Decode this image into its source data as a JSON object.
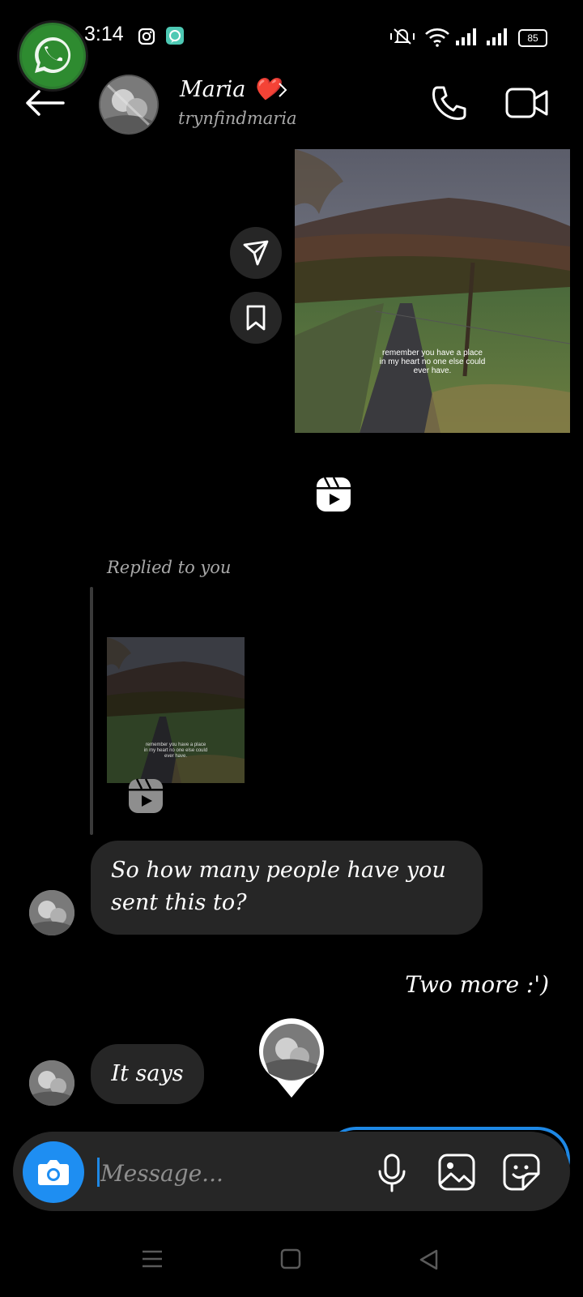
{
  "status_bar": {
    "time": "3:14",
    "battery": "85",
    "icons": [
      "whatsapp-bubble-icon",
      "instagram-icon",
      "chat-app-icon",
      "mute-vibrate-icon",
      "wifi-icon",
      "signal-icon",
      "signal-icon",
      "battery-icon"
    ]
  },
  "header": {
    "name": "Maria ❤️",
    "username": "trynfindmaria",
    "icons": [
      "back-arrow-icon",
      "chevron-right-icon",
      "phone-icon",
      "video-call-icon"
    ]
  },
  "shared_post": {
    "caption_lines": [
      "remember you have a place",
      "in my heart no one else could",
      "ever have."
    ],
    "icons": [
      "send-icon",
      "bookmark-icon",
      "reels-icon"
    ]
  },
  "reply": {
    "label": "Replied to you",
    "caption_lines": [
      "remember you have a place",
      "in my heart no one else could",
      "ever have."
    ]
  },
  "messages": [
    {
      "from": "them",
      "text": "So how many people have you sent this to?"
    },
    {
      "from": "me",
      "text": "Two more :')"
    },
    {
      "from": "them",
      "text": "It says"
    }
  ],
  "composer": {
    "placeholder": "Message...",
    "icons": [
      "camera-icon",
      "microphone-icon",
      "gallery-icon",
      "sticker-icon"
    ]
  },
  "colors": {
    "accent": "#1e88e5",
    "bubble": "#262626",
    "background": "#000000"
  }
}
